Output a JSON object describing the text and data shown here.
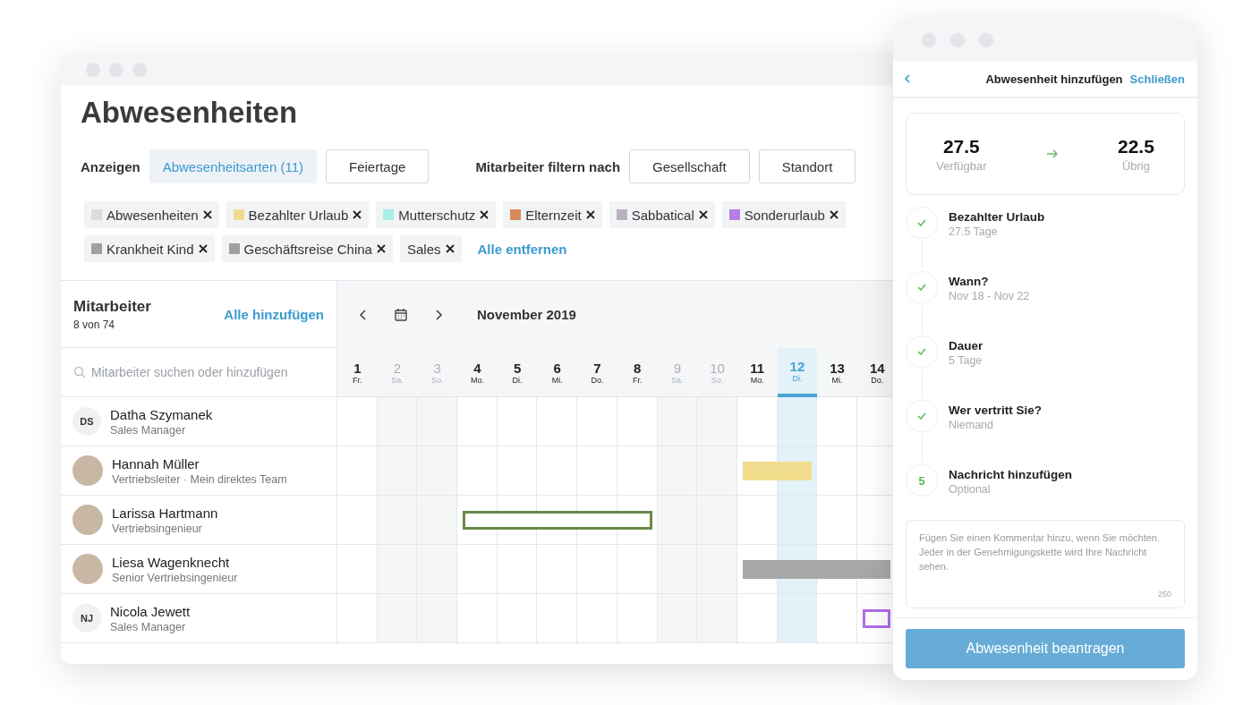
{
  "main": {
    "title": "Abwesenheiten",
    "show_label": "Anzeigen",
    "show_filters": [
      {
        "label": "Abwesenheitsarten (11)",
        "selected": true
      },
      {
        "label": "Feiertage",
        "selected": false
      }
    ],
    "employee_filter_label": "Mitarbeiter filtern nach",
    "employee_filters": [
      {
        "label": "Gesellschaft",
        "selected": false
      },
      {
        "label": "Standort",
        "selected": false
      }
    ],
    "chips": [
      {
        "label": "Abwesenheiten",
        "color": "#dcdcdc"
      },
      {
        "label": "Bezahlter Urlaub",
        "color": "#f0dc8c"
      },
      {
        "label": "Mutterschutz",
        "color": "#a8efe6"
      },
      {
        "label": "Elternzeit",
        "color": "#d98a5a"
      },
      {
        "label": "Sabbatical",
        "color": "#bbb0bd"
      },
      {
        "label": "Sonderurlaub",
        "color": "#b77ee8"
      },
      {
        "label": "Krankheit Kind",
        "color": "#a0a0a0"
      },
      {
        "label": "Geschäftsreise China",
        "color": "#a0a0a0"
      },
      {
        "label": "Sales"
      }
    ],
    "remove_all": "Alle entfernen",
    "employees": {
      "title": "Mitarbeiter",
      "count": "8 von 74",
      "add_all": "Alle hinzufügen",
      "search_placeholder": "Mitarbeiter suchen oder hinzufügen"
    },
    "month": "November 2019",
    "days": [
      {
        "day": "1",
        "weekday": "Fr.",
        "weekend": false,
        "today": false
      },
      {
        "day": "2",
        "weekday": "Sa.",
        "weekend": true,
        "today": false
      },
      {
        "day": "3",
        "weekday": "So.",
        "weekend": true,
        "today": false
      },
      {
        "day": "4",
        "weekday": "Mo.",
        "weekend": false,
        "today": false
      },
      {
        "day": "5",
        "weekday": "Di.",
        "weekend": false,
        "today": false
      },
      {
        "day": "6",
        "weekday": "Mi.",
        "weekend": false,
        "today": false
      },
      {
        "day": "7",
        "weekday": "Do.",
        "weekend": false,
        "today": false
      },
      {
        "day": "8",
        "weekday": "Fr.",
        "weekend": false,
        "today": false
      },
      {
        "day": "9",
        "weekday": "Sa.",
        "weekend": true,
        "today": false
      },
      {
        "day": "10",
        "weekday": "So.",
        "weekend": true,
        "today": false
      },
      {
        "day": "11",
        "weekday": "Mo.",
        "weekend": false,
        "today": false
      },
      {
        "day": "12",
        "weekday": "Di.",
        "weekend": false,
        "today": true
      },
      {
        "day": "13",
        "weekday": "Mi.",
        "weekend": false,
        "today": false
      },
      {
        "day": "14",
        "weekday": "Do.",
        "weekend": false,
        "today": false
      }
    ],
    "rows": [
      {
        "name": "Datha Szymanek",
        "role": "Sales Manager",
        "initials": "DS",
        "booked": [
          false,
          false,
          false,
          false,
          false,
          false,
          false,
          false,
          false,
          false,
          false,
          false,
          false,
          false
        ]
      },
      {
        "name": "Hannah Müller",
        "role": "Vertriebsleiter · Mein direktes Team",
        "absence": {
          "kind": "filled",
          "color": "#f0dc8c"
        },
        "booked": [
          false,
          false,
          false,
          false,
          false,
          false,
          false,
          false,
          false,
          false,
          true,
          true,
          false,
          false
        ]
      },
      {
        "name": "Larissa Hartmann",
        "role": "Vertriebsingenieur",
        "absence": {
          "kind": "outline",
          "color": "#6a8a4a"
        },
        "booked": [
          false,
          false,
          false,
          true,
          true,
          true,
          true,
          true,
          false,
          false,
          false,
          false,
          false,
          false
        ]
      },
      {
        "name": "Liesa Wagenknecht",
        "role": "Senior Vertriebsingenieur",
        "absence": {
          "kind": "filled",
          "color": "#a8a8a8"
        },
        "booked": [
          false,
          false,
          false,
          false,
          false,
          false,
          false,
          false,
          false,
          false,
          true,
          true,
          true,
          true
        ]
      },
      {
        "name": "Nicola Jewett",
        "role": "Sales Manager",
        "initials": "NJ",
        "absence": {
          "kind": "outline",
          "color": "#b06ee8"
        },
        "booked": [
          false,
          false,
          false,
          false,
          false,
          false,
          false,
          false,
          false,
          false,
          false,
          false,
          false,
          true
        ]
      }
    ]
  },
  "panel": {
    "title": "Abwesenheit hinzufügen",
    "close": "Schließen",
    "available": {
      "value": "27.5",
      "label": "Verfügbar"
    },
    "remaining": {
      "value": "22.5",
      "label": "Übrig"
    },
    "steps": [
      {
        "title": "Bezahlter Urlaub",
        "detail": "27.5 Tage",
        "done": true
      },
      {
        "title": "Wann?",
        "detail": "Nov 18 - Nov 22",
        "done": true
      },
      {
        "title": "Dauer",
        "detail": "5 Tage",
        "done": true
      },
      {
        "title": "Wer vertritt Sie?",
        "detail": "Niemand",
        "done": true
      },
      {
        "title": "Nachricht hinzufügen",
        "detail": "Optional",
        "done": false,
        "number": "5"
      }
    ],
    "comment_placeholder": "Fügen Sie einen Kommentar hinzu, wenn Sie möchten. Jeder in der Genehmigungskette wird Ihre Nachricht sehen.",
    "char_count": "250",
    "submit": "Abwesenheit beantragen"
  }
}
